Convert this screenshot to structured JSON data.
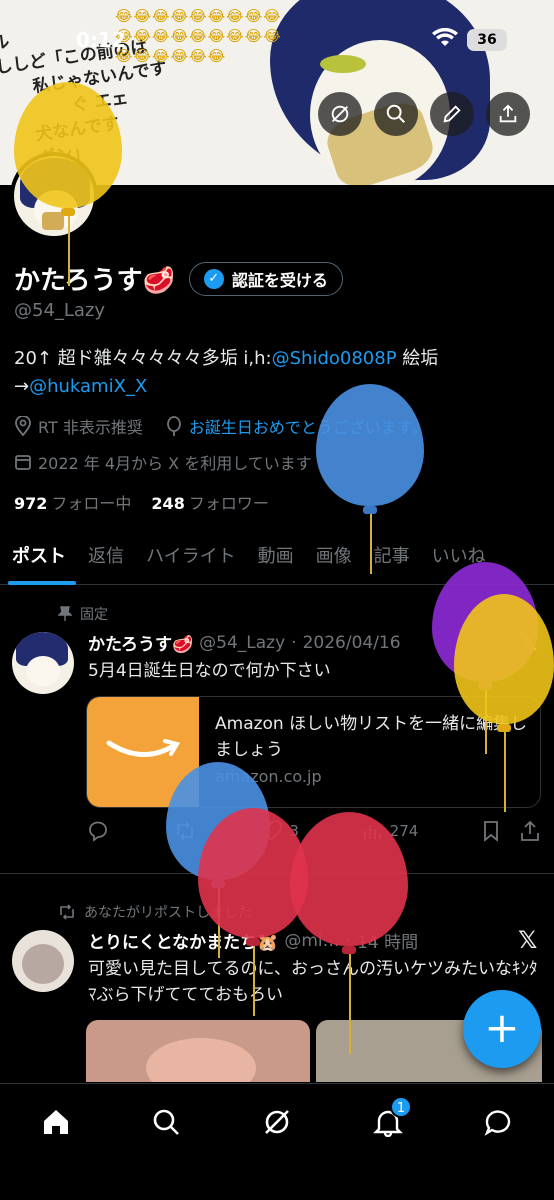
{
  "status": {
    "time": "0:12",
    "battery": "36"
  },
  "banner": {
    "manga_lines": [
      "ル",
      "ししど「この前のは",
      "私じゃないんです",
      "ぐ エェ",
      "犬なんです",
      "ダン」"
    ],
    "emojis": "😂😂😂😂😂😂😂😂😂😂😂😂😂😂😂😂😂😂😂😂😂😂😂😂"
  },
  "profile": {
    "display_name": "かたろうす🥩",
    "verify_label": "認証を受ける",
    "handle": "@54_Lazy",
    "bio_prefix": "20↑ 超ド雑々々々々々多垢 i,h:",
    "bio_link1": "@Shido0808P",
    "bio_mid": " 絵垢",
    "bio_arrow": "→",
    "bio_link2": "@hukamiX_X",
    "rt_note": "RT 非表示推奨",
    "birthday_link": "お誕生日おめでとうございます。",
    "joined": "2022 年 4月から X を利用しています",
    "following_count": "972",
    "following_label": "フォロー中",
    "followers_count": "248",
    "followers_label": "フォロワー"
  },
  "tabs": [
    "ポスト",
    "返信",
    "ハイライト",
    "動画",
    "画像",
    "記事",
    "いいね"
  ],
  "posts": [
    {
      "pinned_label": "固定",
      "name": "かたろうす🥩",
      "handle": "@54_Lazy",
      "date": "2026/04/16",
      "text": "5月4日誕生日なので何か下さい",
      "card": {
        "title": "Amazon ほしい物リストを一緒に編集しましょう",
        "domain": "amazon.co.jp"
      },
      "reply_count": "",
      "repost_count": "",
      "like_count": "3",
      "views": "274"
    },
    {
      "repost_label": "あなたがリポストしました",
      "name": "とりにくとなかまたち🐹",
      "handle": "@mi…",
      "time": "14 時間",
      "text": "可愛い見た目してるのに、おっさんの汚いケツみたいなｷﾝﾀﾏぶら下げててておもろい"
    }
  ],
  "fab_label": "+",
  "nav": {
    "notification_badge": "1"
  },
  "icons": {
    "header": [
      "grok-icon",
      "search-icon",
      "edit-icon",
      "share-icon"
    ],
    "nav": [
      "home-icon",
      "search-icon",
      "grok-icon",
      "bell-icon",
      "messages-icon"
    ]
  },
  "colors": {
    "accent": "#1d9bf0",
    "background": "#000000",
    "muted": "#71767b",
    "balloon_blue": "#4a90e2",
    "balloon_yellow": "#f0c419",
    "balloon_red": "#e0334d",
    "balloon_purple": "#8e2bd8"
  }
}
